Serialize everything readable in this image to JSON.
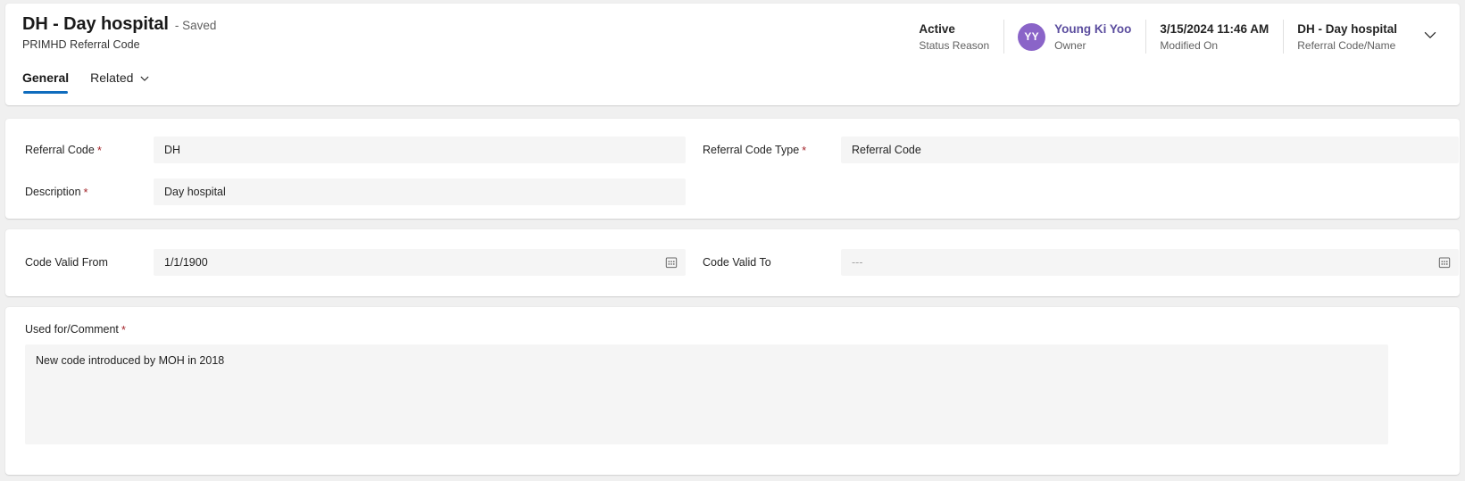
{
  "header": {
    "record_title": "DH - Day hospital",
    "saved_state": "- Saved",
    "entity_name": "PRIMHD Referral Code",
    "tabs": [
      {
        "label": "General",
        "active": true,
        "has_caret": false
      },
      {
        "label": "Related",
        "active": false,
        "has_caret": true
      }
    ],
    "meta": [
      {
        "value": "Active",
        "label": "Status Reason"
      },
      {
        "value": "Young Ki Yoo",
        "label": "Owner",
        "avatar_initials": "YY",
        "avatar_color": "#8a64c8",
        "link_color": "#5b4d9e"
      },
      {
        "value": "3/15/2024 11:46 AM",
        "label": "Modified On"
      },
      {
        "value": "DH - Day hospital",
        "label": "Referral Code/Name"
      }
    ],
    "expand_icon": "chevron-down-icon",
    "accent_color": "#0f6cbd"
  },
  "form": {
    "identity_section": {
      "referral_code": {
        "label": "Referral Code",
        "required": true,
        "value": "DH"
      },
      "referral_code_type": {
        "label": "Referral Code Type",
        "required": true,
        "value": "Referral Code"
      },
      "description": {
        "label": "Description",
        "required": true,
        "value": "Day hospital"
      }
    },
    "validity_section": {
      "code_valid_from": {
        "label": "Code Valid From",
        "required": false,
        "value": "1/1/1900",
        "icon": "calendar-icon"
      },
      "code_valid_to": {
        "label": "Code Valid To",
        "required": false,
        "value": "---",
        "is_placeholder": true,
        "icon": "calendar-icon"
      }
    },
    "comment_section": {
      "used_for_comment": {
        "label": "Used for/Comment",
        "required": true,
        "value": "New code introduced by MOH in 2018"
      }
    }
  },
  "colors": {
    "required_asterisk": "#a4262c",
    "input_background": "#f5f5f5",
    "page_background": "#f0f0f0",
    "card_background": "#ffffff"
  }
}
